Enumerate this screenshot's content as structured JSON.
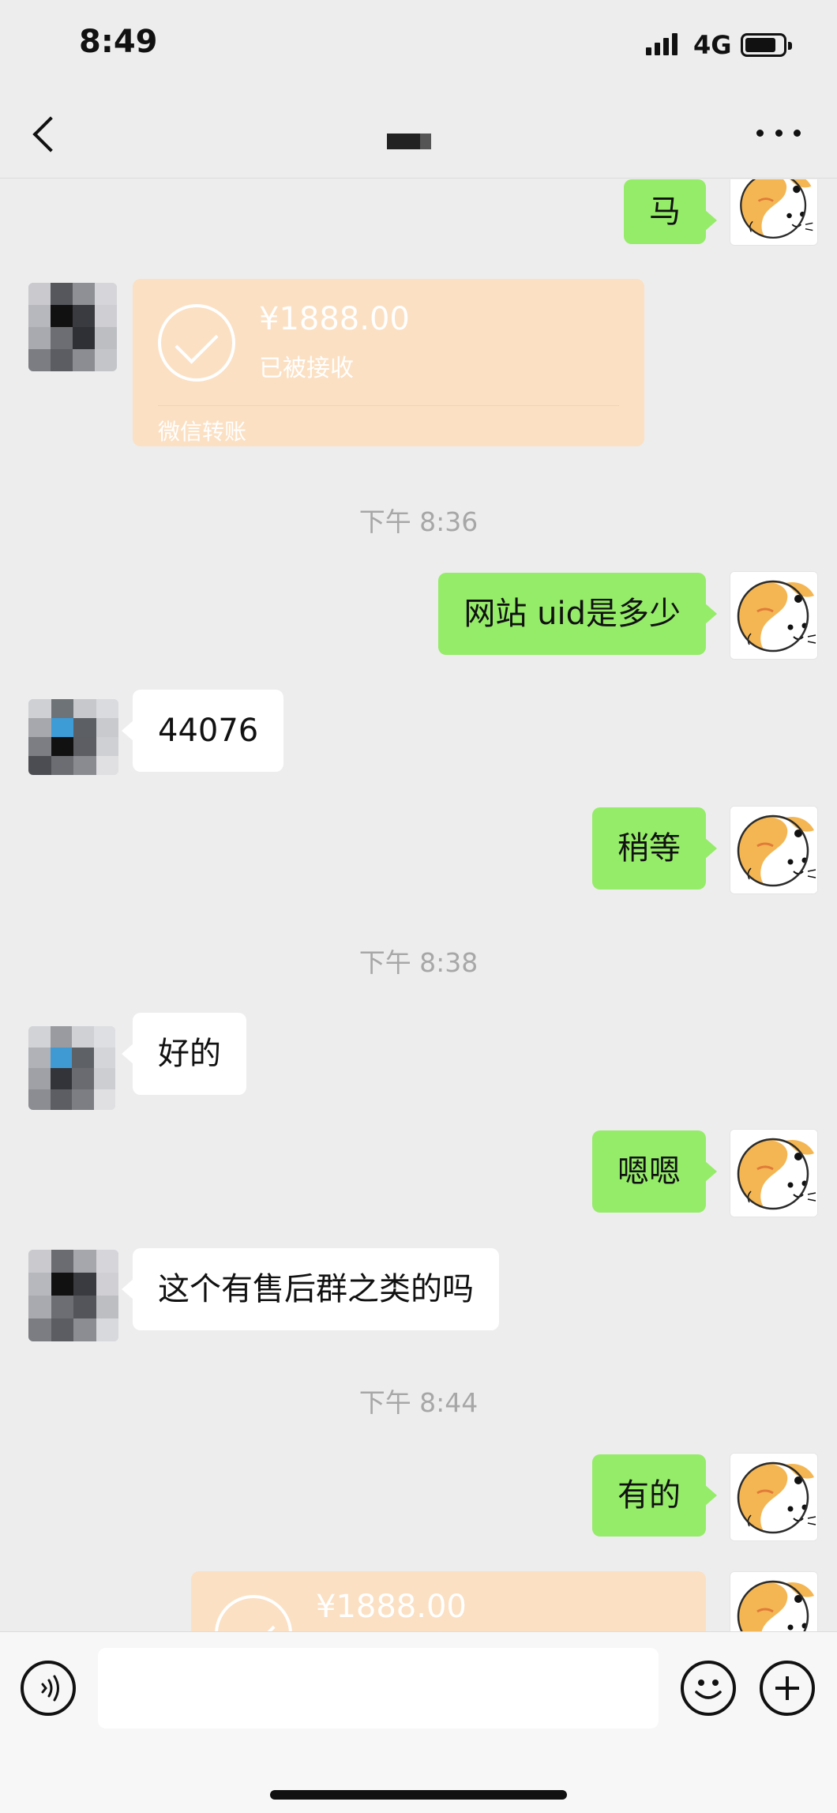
{
  "status_bar": {
    "time": "8:49",
    "network": "4G"
  },
  "nav": {
    "title": ""
  },
  "messages": [
    {
      "type": "text",
      "side": "right",
      "text": "马"
    },
    {
      "type": "transfer",
      "side": "left",
      "amount": "¥1888.00",
      "status": "已被接收",
      "footer": "微信转账"
    },
    {
      "type": "time",
      "text": "下午 8:36"
    },
    {
      "type": "text",
      "side": "right",
      "text": "网站 uid是多少"
    },
    {
      "type": "text",
      "side": "left",
      "text": "44076"
    },
    {
      "type": "text",
      "side": "right",
      "text": "稍等"
    },
    {
      "type": "time",
      "text": "下午 8:38"
    },
    {
      "type": "text",
      "side": "left",
      "text": "好的"
    },
    {
      "type": "text",
      "side": "right",
      "text": "嗯嗯"
    },
    {
      "type": "text",
      "side": "left",
      "text": "这个有售后群之类的吗"
    },
    {
      "type": "time",
      "text": "下午 8:44"
    },
    {
      "type": "text",
      "side": "right",
      "text": "有的"
    },
    {
      "type": "transfer",
      "side": "right",
      "amount": "¥1888.00"
    }
  ],
  "input": {
    "placeholder": ""
  },
  "colors": {
    "my_bubble": "#95ec69",
    "their_bubble": "#ffffff",
    "transfer_card": "#fbe0c3",
    "background": "#ededed"
  },
  "icons": {
    "back": "chevron-left-icon",
    "more": "more-dots-icon",
    "voice": "voice-icon",
    "emoji": "emoji-icon",
    "plus": "plus-icon"
  }
}
